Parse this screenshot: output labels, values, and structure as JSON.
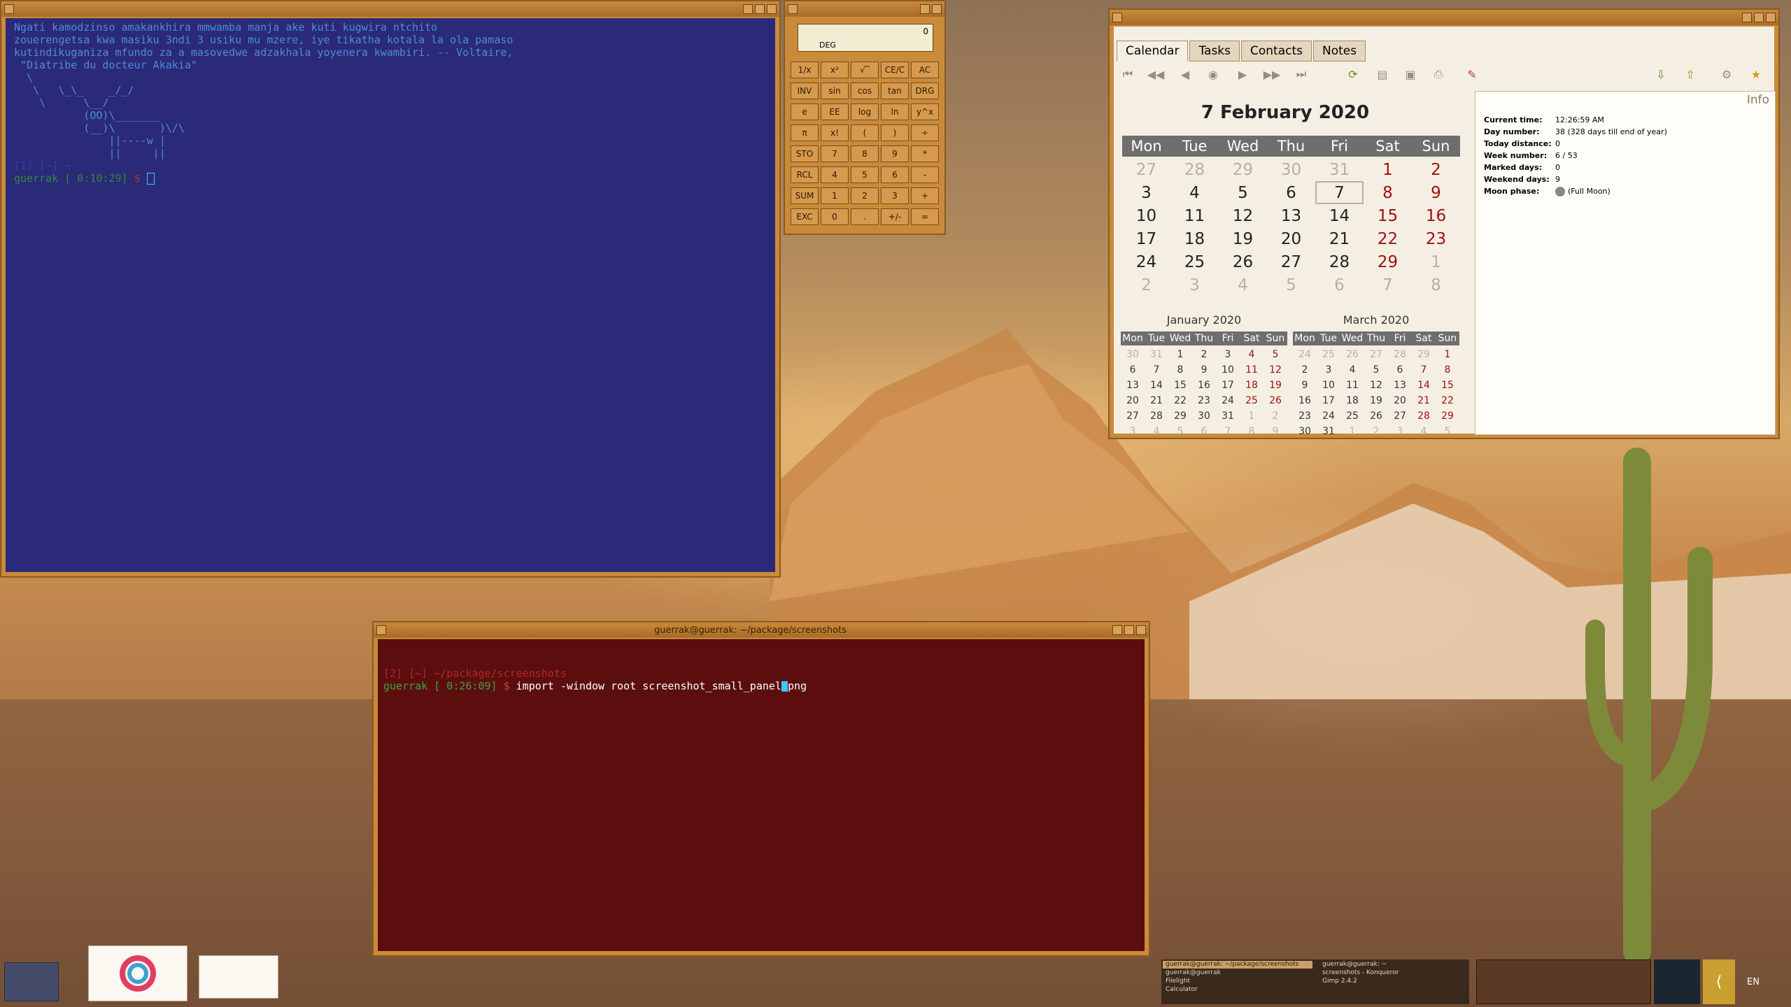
{
  "terminal1": {
    "lines": [
      "Ngati kamodzinso amakankhira mmwamba manja ake kuti kugwira ntchito",
      "zouerengetsa kwa masiku 3ndi 3 usiku mu mzere, iye tikatha kotala la ola pamaso",
      "kutindikuganiza mfundo za a masovedwe adzakhala yoyenera kwambiri. -- Voltaire,",
      " \"Diatribe du docteur Akakia\"",
      "  \\",
      "   \\   \\_\\_    _/_/",
      "    \\      \\__/",
      "           (OO)\\_______",
      "           (__)\\       )\\/\\",
      "               ||----w |",
      "               ||     ||",
      "",
      "",
      "[1] [~] ~"
    ],
    "prompt_user": "guerrak",
    "prompt_time": "[ 0:10:29]",
    "prompt_sym": "$"
  },
  "calculator": {
    "display": "0",
    "mode": "DEG",
    "buttons": [
      [
        "1/x",
        "x²",
        "√‾",
        "CE/C",
        "AC"
      ],
      [
        "INV",
        "sin",
        "cos",
        "tan",
        "DRG"
      ],
      [
        "e",
        "EE",
        "log",
        "ln",
        "y^x"
      ],
      [
        "π",
        "x!",
        "(",
        ")",
        "÷"
      ],
      [
        "STO",
        "7",
        "8",
        "9",
        "*"
      ],
      [
        "RCL",
        "4",
        "5",
        "6",
        "-"
      ],
      [
        "SUM",
        "1",
        "2",
        "3",
        "+"
      ],
      [
        "EXC",
        "0",
        ".",
        "+/-",
        "="
      ]
    ]
  },
  "calendar": {
    "tabs": [
      "Calendar",
      "Tasks",
      "Contacts",
      "Notes"
    ],
    "big_date": "7 February 2020",
    "day_headers": [
      "Mon",
      "Tue",
      "Wed",
      "Thu",
      "Fri",
      "Sat",
      "Sun"
    ],
    "weeks": [
      [
        "27",
        "28",
        "29",
        "30",
        "31",
        "1",
        "2"
      ],
      [
        "3",
        "4",
        "5",
        "6",
        "7",
        "8",
        "9"
      ],
      [
        "10",
        "11",
        "12",
        "13",
        "14",
        "15",
        "16"
      ],
      [
        "17",
        "18",
        "19",
        "20",
        "21",
        "22",
        "23"
      ],
      [
        "24",
        "25",
        "26",
        "27",
        "28",
        "29",
        "1"
      ],
      [
        "2",
        "3",
        "4",
        "5",
        "6",
        "7",
        "8"
      ]
    ],
    "mini_left": {
      "title": "January 2020",
      "weeks": [
        [
          "30",
          "31",
          "1",
          "2",
          "3",
          "4",
          "5"
        ],
        [
          "6",
          "7",
          "8",
          "9",
          "10",
          "11",
          "12"
        ],
        [
          "13",
          "14",
          "15",
          "16",
          "17",
          "18",
          "19"
        ],
        [
          "20",
          "21",
          "22",
          "23",
          "24",
          "25",
          "26"
        ],
        [
          "27",
          "28",
          "29",
          "30",
          "31",
          "1",
          "2"
        ],
        [
          "3",
          "4",
          "5",
          "6",
          "7",
          "8",
          "9"
        ]
      ]
    },
    "mini_right": {
      "title": "March 2020",
      "weeks": [
        [
          "24",
          "25",
          "26",
          "27",
          "28",
          "29",
          "1"
        ],
        [
          "2",
          "3",
          "4",
          "5",
          "6",
          "7",
          "8"
        ],
        [
          "9",
          "10",
          "11",
          "12",
          "13",
          "14",
          "15"
        ],
        [
          "16",
          "17",
          "18",
          "19",
          "20",
          "21",
          "22"
        ],
        [
          "23",
          "24",
          "25",
          "26",
          "27",
          "28",
          "29"
        ],
        [
          "30",
          "31",
          "1",
          "2",
          "3",
          "4",
          "5"
        ]
      ]
    },
    "info": {
      "title": "Info",
      "rows": [
        {
          "label": "Current time:",
          "value": "12:26:59 AM"
        },
        {
          "label": "Day number:",
          "value": "38 (328 days till end of year)"
        },
        {
          "label": "Today distance:",
          "value": "0"
        },
        {
          "label": "Week number:",
          "value": "6 / 53"
        },
        {
          "label": "Marked days:",
          "value": "0"
        },
        {
          "label": "Weekend days:",
          "value": "9"
        },
        {
          "label": "Moon phase:",
          "value": "(Full Moon)"
        }
      ]
    }
  },
  "terminal2": {
    "title": "guerrak@guerrak: ~/package/screenshots",
    "line1": "[2] [~] ~/package/screenshots",
    "prompt_user": "guerrak",
    "prompt_time": "[ 0:26:09]",
    "prompt_sym": "$",
    "command_before": "import -window root screenshot_small_panel",
    "command_after": "png"
  },
  "panel": {
    "tasks": [
      "guerrak@guerrak: ~/package/screenshots",
      "guerrak@guerrak",
      "Filelight",
      "Calculator",
      "guerrak@guerrak: ~",
      "screenshots - Konqueror",
      "Gimp 2.4.2"
    ],
    "lang": "EN"
  }
}
